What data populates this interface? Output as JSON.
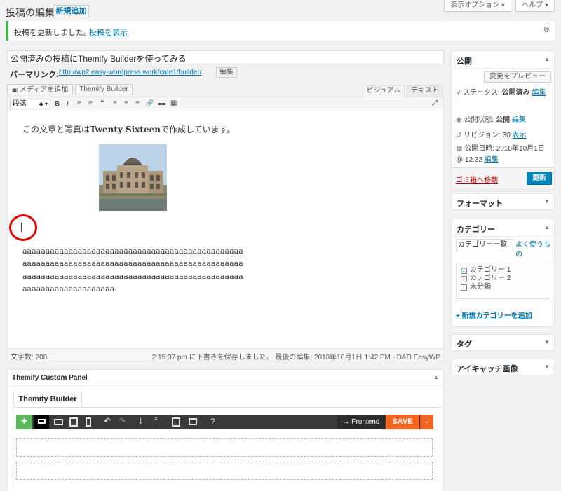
{
  "header": {
    "title": "投稿の編集",
    "add_new": "新規追加",
    "screen_options": "表示オプション ▾",
    "help": "ヘルプ ▾"
  },
  "notice": {
    "message": "投稿を更新しました。",
    "link": "投稿を表示"
  },
  "post": {
    "title": "公開済みの投稿にThemify Builderを使ってみる",
    "permalink_label": "パーマリンク:",
    "permalink_url": "http://wp2.easy-wordpress.work/cate1/builder/",
    "permalink_edit": "編集"
  },
  "editor": {
    "add_media": "メディアを追加",
    "themify_builder_btn": "Themify Builder",
    "tab_visual": "ビジュアル",
    "tab_text": "テキスト",
    "format_select": "段落",
    "toolbar_icons": [
      "B",
      "I",
      "≡",
      "≡",
      "❝",
      "≡",
      "≡",
      "≡",
      "🔗",
      "▬",
      "▦"
    ],
    "paragraph_prefix": "この文章と写真は",
    "paragraph_bold": "Twenty Sixteen",
    "paragraph_suffix": "で作成しています。",
    "cursor": "|",
    "long_text": "aaaaaaaaaaaaaaaaaaaaaaaaaaaaaaaaaaaaaaaaaaaaaaaaaaaaaaaaaaaaaaaaaaaaaaaaaaaaaaaaaaaaaaaaaaaaaaaaaaaaaaaaaaaaaaaaaaaaaaaaaaaaaaaaaaaaaaaaaaaaaaaaaaaaaaaaaaaaaaaaaaaa.",
    "word_count": "文字数: 208",
    "status": "2:15:37 pm に下書きを保存しました。 最後の編集: 2018年10月1日 1:42 PM - D&D EasyWP"
  },
  "publish": {
    "title": "公開",
    "preview": "変更をプレビュー",
    "status_label": "ステータス:",
    "status_value": "公開済み",
    "status_edit": "編集",
    "visibility_label": "公開状態:",
    "visibility_value": "公開",
    "visibility_edit": "編集",
    "revisions_label": "リビジョン: 30",
    "revisions_link": "表示",
    "date_label": "公開日時: 2018年10月1日 @ 12:32",
    "date_edit": "編集",
    "trash": "ゴミ箱へ移動",
    "update": "更新"
  },
  "format_box": {
    "title": "フォーマット"
  },
  "category_box": {
    "title": "カテゴリー",
    "tab_all": "カテゴリー一覧",
    "tab_popular": "よく使うもの",
    "items": [
      {
        "label": "カテゴリー 1",
        "checked": "☑"
      },
      {
        "label": "カテゴリー 2",
        "checked": "☐"
      },
      {
        "label": "未分類",
        "checked": "☐"
      }
    ],
    "add_new": "+ 新規カテゴリーを追加"
  },
  "tag_box": {
    "title": "タグ"
  },
  "eyecatch_box": {
    "title": "アイキャッチ画像"
  },
  "themify_panel": {
    "title": "Themify Custom Panel",
    "tab": "Themify Builder",
    "plus": "+",
    "help": "?",
    "frontend": "→ Frontend",
    "save": "SAVE",
    "save_arrow": "⌄"
  },
  "colors": {
    "accent": "#0073aa",
    "builder_green": "#5cb85c",
    "builder_orange": "#f26522",
    "highlight_red": "#e00000"
  }
}
